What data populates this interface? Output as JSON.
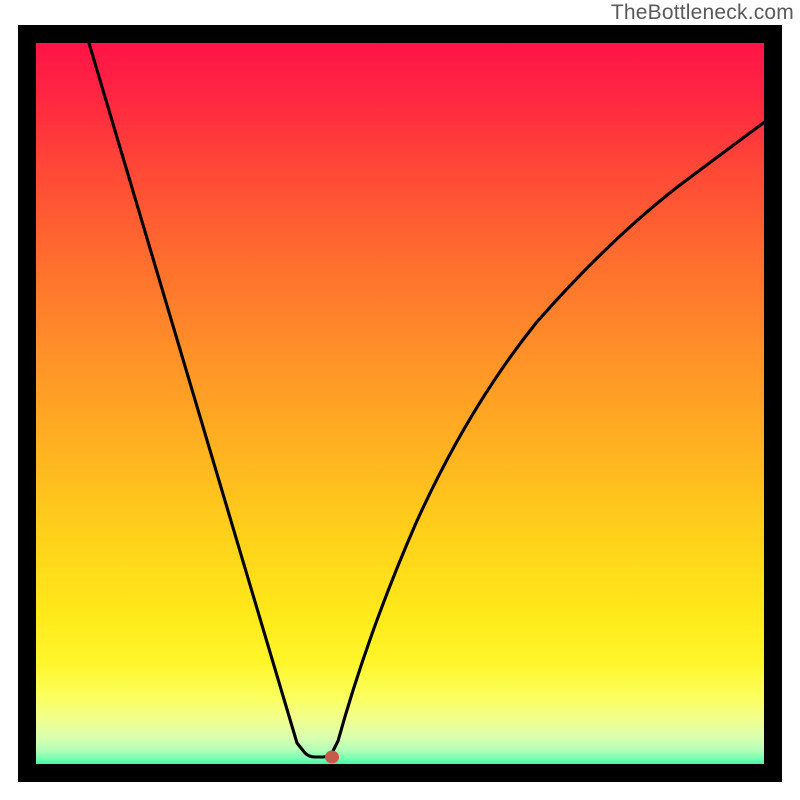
{
  "attribution": "TheBottleneck.com",
  "chart_data": {
    "type": "line",
    "title": "",
    "xlabel": "",
    "ylabel": "",
    "xlim": [
      0,
      100
    ],
    "ylim": [
      0,
      100
    ],
    "background_gradient": {
      "direction": "vertical",
      "meaning": "bottleneck severity (red high, green low)",
      "stops": [
        {
          "pos": 0.0,
          "color": "#ff1448"
        },
        {
          "pos": 0.08,
          "color": "#ff2840"
        },
        {
          "pos": 0.18,
          "color": "#ff4a36"
        },
        {
          "pos": 0.3,
          "color": "#ff6e2e"
        },
        {
          "pos": 0.42,
          "color": "#ff8f28"
        },
        {
          "pos": 0.55,
          "color": "#ffb021"
        },
        {
          "pos": 0.68,
          "color": "#ffd21a"
        },
        {
          "pos": 0.78,
          "color": "#ffe81a"
        },
        {
          "pos": 0.85,
          "color": "#fff62a"
        },
        {
          "pos": 0.9,
          "color": "#fbff60"
        },
        {
          "pos": 0.93,
          "color": "#f0ff90"
        },
        {
          "pos": 0.955,
          "color": "#d8ffb0"
        },
        {
          "pos": 0.972,
          "color": "#b0ffb8"
        },
        {
          "pos": 0.984,
          "color": "#70ffb0"
        },
        {
          "pos": 0.993,
          "color": "#30f0a0"
        },
        {
          "pos": 1.0,
          "color": "#00e090"
        }
      ]
    },
    "series": [
      {
        "name": "bottleneck-curve",
        "x": [
          7,
          12,
          18,
          24,
          30,
          36,
          37,
          38,
          39,
          40,
          41,
          44,
          48,
          54,
          62,
          70,
          80,
          90,
          100
        ],
        "y": [
          100,
          84,
          66,
          47,
          28,
          9,
          3,
          1,
          1,
          1,
          3,
          12,
          24,
          40,
          55,
          66,
          76,
          83,
          89
        ]
      }
    ],
    "marker": {
      "name": "optimum-point",
      "x": 40.5,
      "y": 1,
      "color": "#c85a4a"
    }
  }
}
